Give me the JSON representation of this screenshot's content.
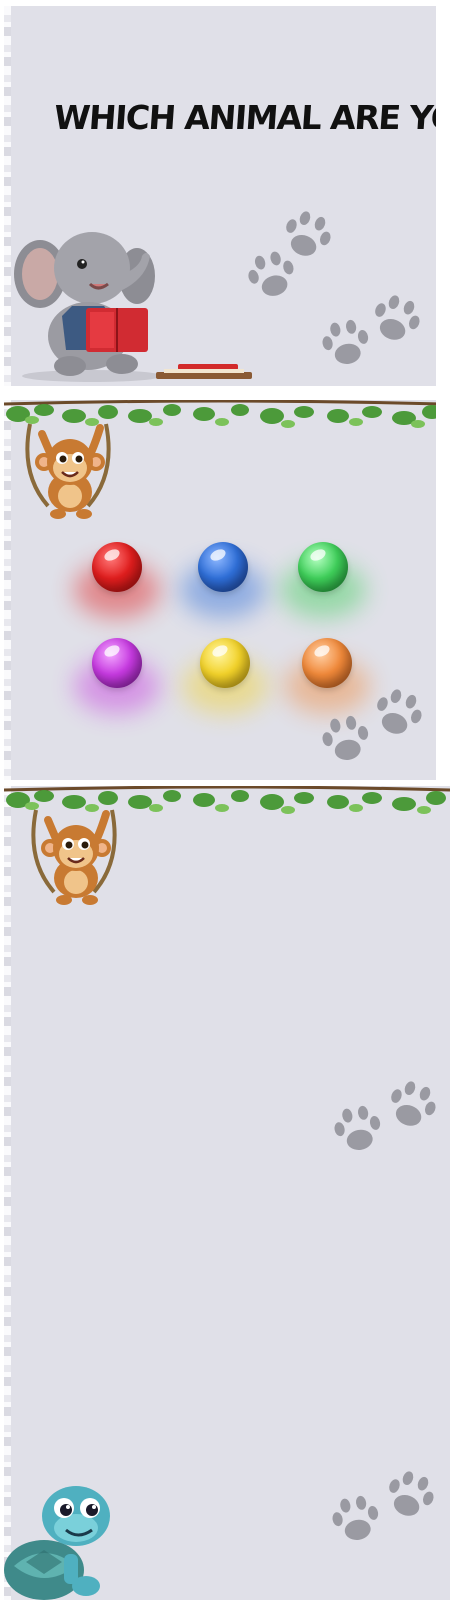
{
  "intro": {
    "title": "WHICH ANIMAL ARE YOU?"
  },
  "colors": {
    "panel_bg": "#e0e0e8",
    "paw": "#9a9aa2"
  },
  "color_picker": {
    "orbs": [
      {
        "name": "red",
        "color": "#e01e1e"
      },
      {
        "name": "blue",
        "color": "#2f6fd8"
      },
      {
        "name": "green",
        "color": "#3fcf5a"
      },
      {
        "name": "purple",
        "color": "#c63ae0"
      },
      {
        "name": "yellow",
        "color": "#f2d22a"
      },
      {
        "name": "orange",
        "color": "#f0893a"
      }
    ]
  },
  "icons": [
    "elephant-icon",
    "books-icon",
    "paw-print-icon",
    "monkey-icon",
    "jungle-leaves-icon",
    "turtle-icon"
  ]
}
